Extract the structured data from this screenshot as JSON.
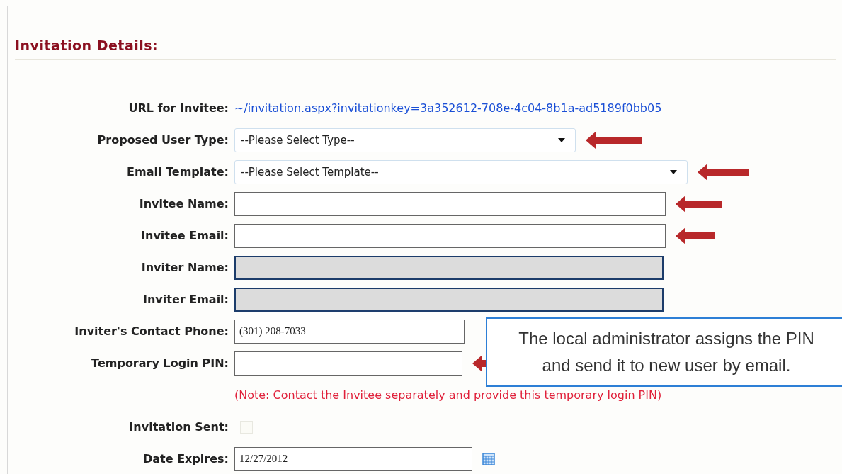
{
  "section": {
    "title": "Invitation Details:"
  },
  "fields": [
    {
      "kind": "link",
      "label": "URL for Invitee:",
      "value": "~/invitation.aspx?invitationkey=3a352612-708e-4c04-8b1a-ad5189f0bb05"
    },
    {
      "kind": "select",
      "label": "Proposed User Type:",
      "value": "--Please Select Type--",
      "flagged": true
    },
    {
      "kind": "select",
      "label": "Email Template:",
      "value": "--Please Select Template--",
      "flagged": true
    },
    {
      "kind": "text",
      "label": "Invitee Name:",
      "flagged": true
    },
    {
      "kind": "text",
      "label": "Invitee Email:",
      "flagged": true
    },
    {
      "kind": "readonly",
      "label": "Inviter Name:"
    },
    {
      "kind": "readonly",
      "label": "Inviter Email:"
    },
    {
      "kind": "text",
      "label": "Inviter's Contact Phone:",
      "value": "(301) 208-7033"
    },
    {
      "kind": "text",
      "label": "Temporary Login PIN:",
      "flagged": true
    },
    {
      "kind": "note",
      "value": "(Note: Contact the Invitee separately and provide this temporary login PIN)"
    },
    {
      "kind": "checkbox",
      "label": "Invitation Sent:",
      "checked": false
    },
    {
      "kind": "date",
      "label": "Date Expires:",
      "value": "12/27/2012"
    }
  ],
  "callout": {
    "text": "The local administrator assigns the PIN and send it to new user by email."
  }
}
